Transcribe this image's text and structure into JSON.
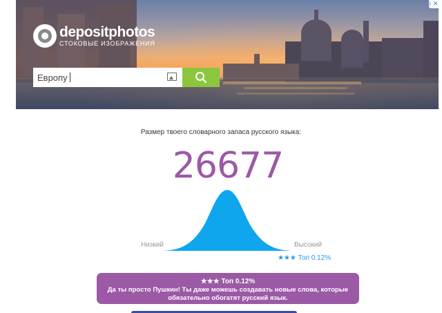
{
  "ad": {
    "logo_name": "depositphotos",
    "logo_tagline": "СТОКОВЫЕ ИЗОБРАЖЕНИЯ",
    "search_value": "Европу",
    "ad_marker": "i ✕",
    "icons": {
      "logo": "camera-lens-icon",
      "image_search": "image-icon",
      "search": "search-icon"
    },
    "colors": {
      "search_button": "#8cc63f"
    }
  },
  "result": {
    "title": "Размер твоего словарного запаса русского языка:",
    "score": "26677",
    "low_label": "Низкий",
    "high_label": "Высокий",
    "rank_badge": "★★★ Топ 0.12%",
    "verdict_rank": "★★★ Топ 0.12%",
    "verdict_text": "Да ты просто Пушкин! Ты даже можешь создавать новые слова, которые обязательно обогатят русский язык.",
    "colors": {
      "score": "#9b59a6",
      "curve": "#0fa6ee",
      "verdict_bg": "#9b59a6",
      "rank_badge": "#1e9be8"
    }
  }
}
